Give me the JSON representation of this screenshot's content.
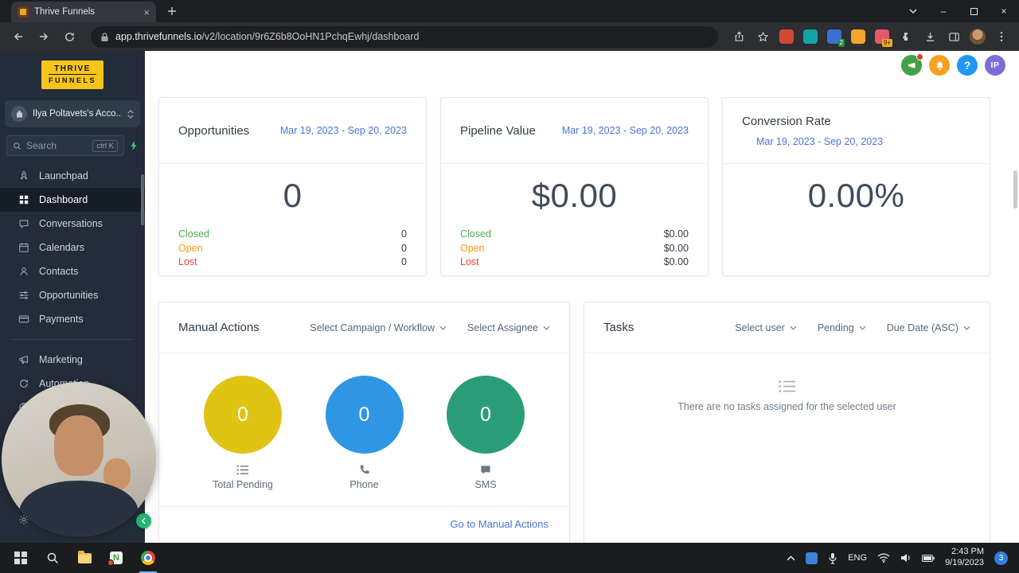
{
  "colors": {
    "status_green": "#4caf50",
    "status_orange": "#ff9800",
    "status_red": "#f44336",
    "link_blue": "#4a74dc",
    "circle_yellow": "#e0c414",
    "circle_blue": "#2e96e3",
    "circle_green": "#2a9d78",
    "sidebar_bg": "#232d39",
    "logo_yellow": "#f5c51d"
  },
  "browser": {
    "tab_title": "Thrive Funnels",
    "url_domain": "app.thrivefunnels.io",
    "url_path": "/v2/location/9r6Z6b8OoHN1PchqEwhj/dashboard",
    "badges": [
      "2",
      "9+"
    ]
  },
  "sidebar": {
    "logo_top": "THRIVE",
    "logo_bottom": "FUNNELS",
    "account_name": "Ilya Poltavets's Acco...",
    "search": {
      "placeholder": "Search",
      "shortcut": "ctrl K"
    },
    "menu": [
      {
        "label": "Launchpad"
      },
      {
        "label": "Dashboard"
      },
      {
        "label": "Conversations"
      },
      {
        "label": "Calendars"
      },
      {
        "label": "Contacts"
      },
      {
        "label": "Opportunities"
      },
      {
        "label": "Payments"
      }
    ],
    "menu_secondary": [
      {
        "label": "Marketing"
      },
      {
        "label": "Automation"
      },
      {
        "label": ""
      },
      {
        "label": ""
      },
      {
        "label": ""
      },
      {
        "label": ""
      }
    ],
    "settings_label": "Settings"
  },
  "header": {
    "help_glyph": "?",
    "avatar_initials": "IP"
  },
  "cards": {
    "opportunities": {
      "title": "Opportunities",
      "date_range": "Mar 19, 2023 - Sep 20, 2023",
      "total": "0",
      "rows": [
        {
          "label": "Closed",
          "value": "0"
        },
        {
          "label": "Open",
          "value": "0"
        },
        {
          "label": "Lost",
          "value": "0"
        }
      ]
    },
    "pipeline": {
      "title": "Pipeline Value",
      "date_range": "Mar 19, 2023 - Sep 20, 2023",
      "total": "$0.00",
      "rows": [
        {
          "label": "Closed",
          "value": "$0.00"
        },
        {
          "label": "Open",
          "value": "$0.00"
        },
        {
          "label": "Lost",
          "value": "$0.00"
        }
      ]
    },
    "conversion": {
      "title": "Conversion Rate",
      "date_range": "Mar 19, 2023 - Sep 20, 2023",
      "total": "0.00%"
    },
    "manual": {
      "title": "Manual Actions",
      "filters": [
        "Select Campaign / Workflow",
        "Select Assignee"
      ],
      "stats": [
        {
          "value": "0",
          "label": "Total Pending"
        },
        {
          "value": "0",
          "label": "Phone"
        },
        {
          "value": "0",
          "label": "SMS"
        }
      ],
      "link": "Go to Manual Actions"
    },
    "tasks": {
      "title": "Tasks",
      "filters": [
        "Select user",
        "Pending",
        "Due Date (ASC)"
      ],
      "empty_text": "There are no tasks assigned for the selected user"
    }
  },
  "taskbar": {
    "language": "ENG",
    "time": "2:43 PM",
    "date": "9/19/2023",
    "notification_count": "3"
  }
}
